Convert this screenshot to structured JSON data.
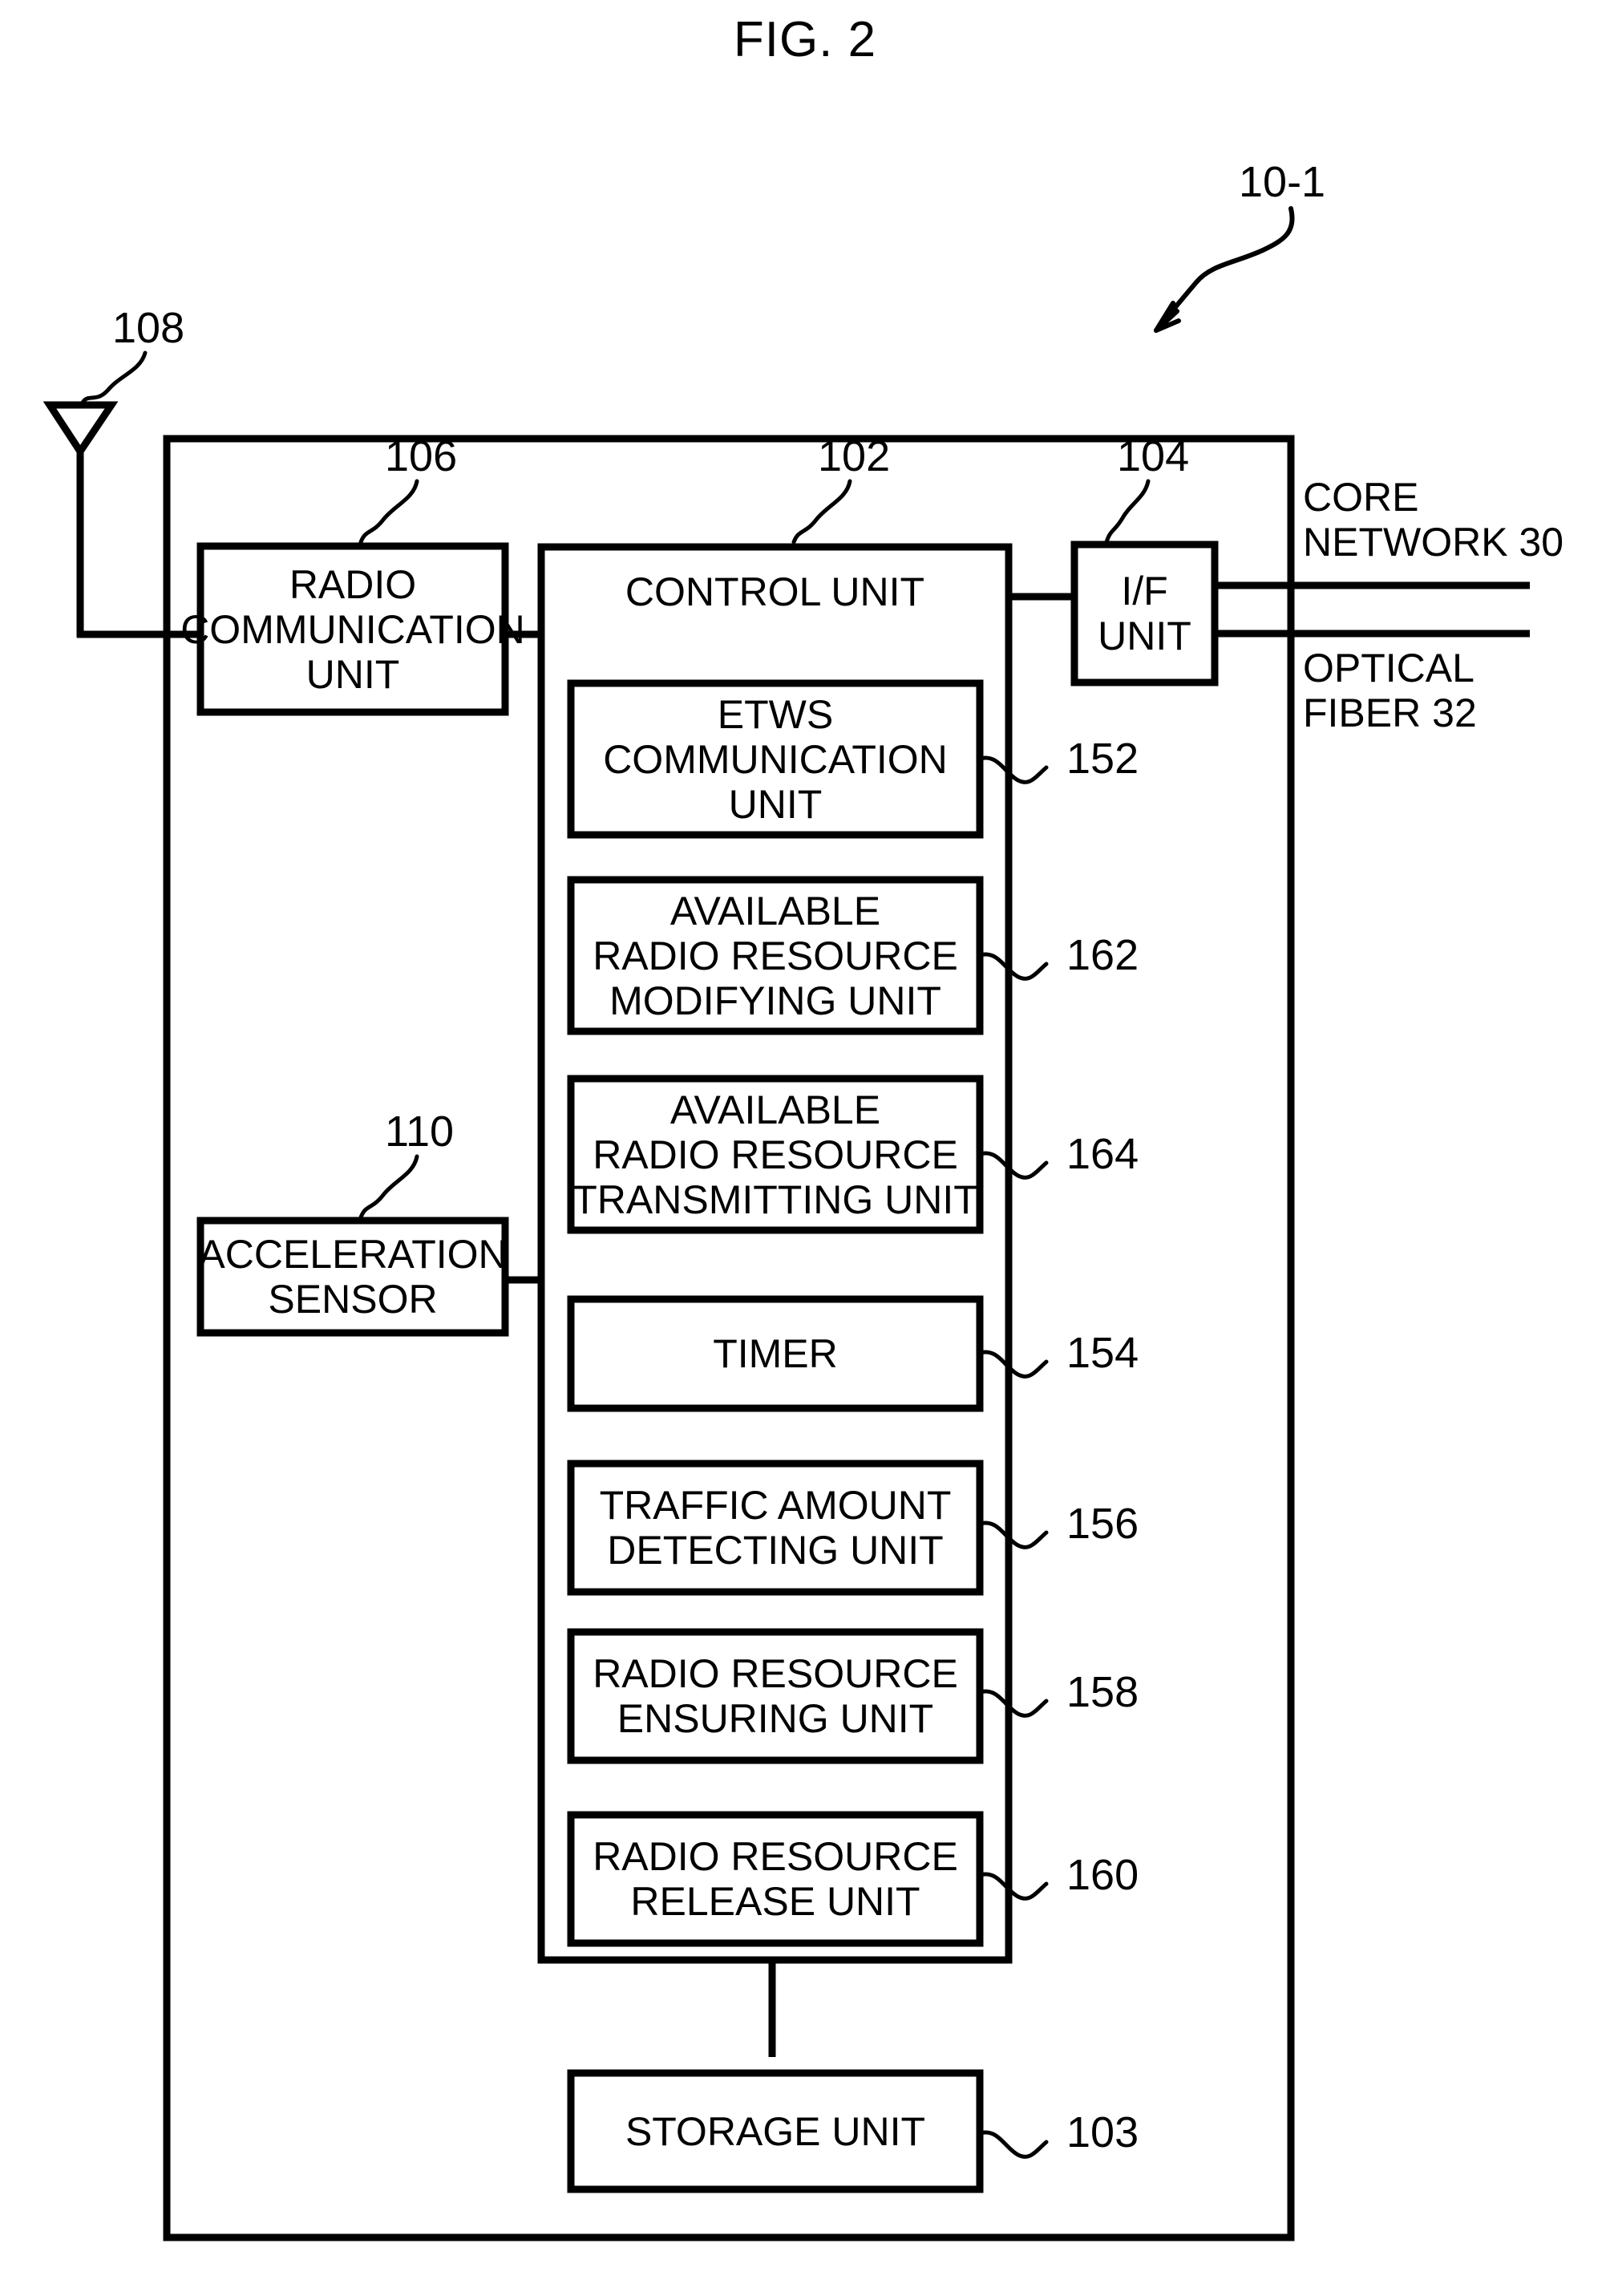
{
  "figure": {
    "title": "FIG. 2",
    "system_ref": "10-1"
  },
  "external": {
    "antenna_ref": "108",
    "core_network_label": "CORE\nNETWORK 30",
    "optical_fiber_label": "OPTICAL\nFIBER 32"
  },
  "blocks": {
    "radio_communication_unit": {
      "label": "RADIO\nCOMMUNICATION\nUNIT",
      "ref": "106"
    },
    "acceleration_sensor": {
      "label": "ACCELERATION\nSENSOR",
      "ref": "110"
    },
    "control_unit": {
      "label": "CONTROL UNIT",
      "ref": "102"
    },
    "if_unit": {
      "label": "I/F\nUNIT",
      "ref": "104"
    },
    "storage_unit": {
      "label": "STORAGE UNIT",
      "ref": "103"
    }
  },
  "control_unit_modules": [
    {
      "label": "ETWS\nCOMMUNICATION\nUNIT",
      "ref": "152"
    },
    {
      "label": "AVAILABLE\nRADIO RESOURCE\nMODIFYING UNIT",
      "ref": "162"
    },
    {
      "label": "AVAILABLE\nRADIO RESOURCE\nTRANSMITTING UNIT",
      "ref": "164"
    },
    {
      "label": "TIMER",
      "ref": "154"
    },
    {
      "label": "TRAFFIC AMOUNT\nDETECTING UNIT",
      "ref": "156"
    },
    {
      "label": "RADIO RESOURCE\nENSURING UNIT",
      "ref": "158"
    },
    {
      "label": "RADIO RESOURCE\nRELEASE UNIT",
      "ref": "160"
    }
  ],
  "colors": {
    "line": "#000000",
    "background": "#ffffff"
  }
}
